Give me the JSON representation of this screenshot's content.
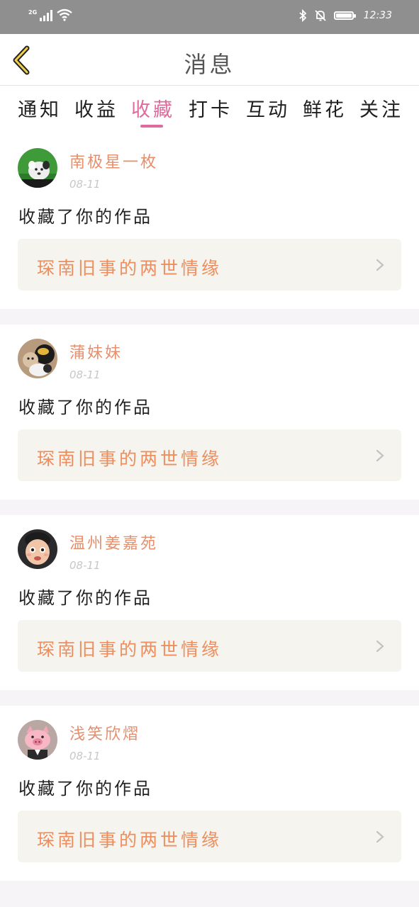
{
  "status": {
    "network": "2G",
    "time": "12:33"
  },
  "header": {
    "title": "消息"
  },
  "tabs": [
    {
      "label": "通知",
      "active": false
    },
    {
      "label": "收益",
      "active": false
    },
    {
      "label": "收藏",
      "active": true
    },
    {
      "label": "打卡",
      "active": false
    },
    {
      "label": "互动",
      "active": false
    },
    {
      "label": "鲜花",
      "active": false
    },
    {
      "label": "关注",
      "active": false
    }
  ],
  "messages": [
    {
      "user": "南极星一枚",
      "date": "08-11",
      "action": "收藏了你的作品",
      "work": "琛南旧事的两世情缘",
      "avatar": "dog"
    },
    {
      "user": "蒲妹妹",
      "date": "08-11",
      "action": "收藏了你的作品",
      "work": "琛南旧事的两世情缘",
      "avatar": "cats"
    },
    {
      "user": "温州姜嘉苑",
      "date": "08-11",
      "action": "收藏了你的作品",
      "work": "琛南旧事的两世情缘",
      "avatar": "child"
    },
    {
      "user": "浅笑欣熠",
      "date": "08-11",
      "action": "收藏了你的作品",
      "work": "琛南旧事的两世情缘",
      "avatar": "pig"
    }
  ],
  "colors": {
    "accent": "#e0699d",
    "username": "#e58f6d",
    "work_title": "#ee8e5e",
    "work_bg": "#f5f4ee"
  }
}
